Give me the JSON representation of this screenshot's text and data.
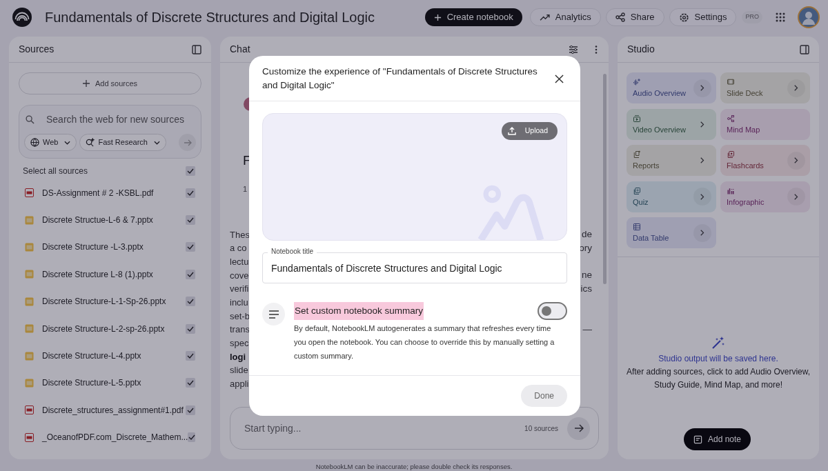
{
  "header": {
    "title": "Fundamentals of Discrete Structures and Digital Logic",
    "buttons": [
      {
        "kind": "primary",
        "label": "Create notebook"
      },
      {
        "kind": "analytics",
        "label": "Analytics"
      },
      {
        "kind": "share",
        "label": "Share"
      },
      {
        "kind": "settings",
        "label": "Settings"
      }
    ],
    "badge": "PRO"
  },
  "sources": {
    "title": "Sources",
    "add_button": "Add sources",
    "search": {
      "placeholder": "Search the web for new sources"
    },
    "chips": [
      "Web",
      "Fast Research"
    ],
    "select_all": {
      "label": "Select all sources",
      "checked": true
    },
    "items": [
      {
        "name": "DS-Assignment # 2 -KSBL.pdf",
        "kind": "pdf",
        "checked": true
      },
      {
        "name": "Discrete Structue-L-6 & 7.pptx",
        "kind": "slides",
        "checked": true
      },
      {
        "name": "Discrete Structure -L-3.pptx",
        "kind": "slides",
        "checked": true
      },
      {
        "name": "Discrete Structure L-8 (1).pptx",
        "kind": "slides",
        "checked": true
      },
      {
        "name": "Discrete Structure-L-1-Sp-26.pptx",
        "kind": "slides",
        "checked": true
      },
      {
        "name": "Discrete Structure-L-2-sp-26.pptx",
        "kind": "slides",
        "checked": true
      },
      {
        "name": "Discrete Structure-L-4.pptx",
        "kind": "slides",
        "checked": true
      },
      {
        "name": "Discrete Structure-L-5.pptx",
        "kind": "slides",
        "checked": true
      },
      {
        "name": "Discrete_structures_assignment#1.pdf",
        "kind": "pdf",
        "checked": true
      },
      {
        "name": "_OceanofPDF.com_Discrete_Mathem...",
        "kind": "pdf",
        "checked": true
      }
    ]
  },
  "chat": {
    "title": "Chat",
    "heading_fragments": [
      "F"
    ],
    "meta_fragment": "1",
    "lines": [
      {
        "start": "Thes",
        "end": "de",
        "bold": false
      },
      {
        "start": "a co",
        "end": "ory",
        "bold": false
      },
      {
        "start": "lectu",
        "bold": false
      },
      {
        "start": "cove",
        "end": "ne",
        "bold": false
      },
      {
        "start": "verifi",
        "end": "ics",
        "bold": false
      },
      {
        "start": "inclu",
        "bold": false
      },
      {
        "start": "set-b",
        "bold": false
      },
      {
        "start": "trans",
        "end": "—",
        "bold": false
      },
      {
        "start": "spec",
        "bold": false
      },
      {
        "start": "logi",
        "bold": true
      },
      {
        "start": "slide",
        "bold": false
      },
      {
        "start": "appli",
        "bold": false
      }
    ],
    "input": {
      "placeholder": "Start typing...",
      "source_count": "10 sources"
    }
  },
  "studio": {
    "title": "Studio",
    "tiles": [
      {
        "label": "Audio Overview",
        "kind": "audio",
        "arrow": true,
        "arrow_button": true
      },
      {
        "label": "Slide Deck",
        "kind": "slides",
        "arrow": true,
        "arrow_button": true
      },
      {
        "label": "Video Overview",
        "kind": "video",
        "arrow": true,
        "arrow_button": false
      },
      {
        "label": "Mind Map",
        "kind": "mindmap",
        "arrow": false
      },
      {
        "label": "Reports",
        "kind": "reports",
        "arrow": true,
        "arrow_button": false
      },
      {
        "label": "Flashcards",
        "kind": "flashcards",
        "arrow": true,
        "arrow_button": true
      },
      {
        "label": "Quiz",
        "kind": "quiz",
        "arrow": true,
        "arrow_button": true
      },
      {
        "label": "Infographic",
        "kind": "infographic",
        "arrow": true,
        "arrow_button": true
      },
      {
        "label": "Data Table",
        "kind": "table",
        "arrow": true,
        "arrow_button": true
      }
    ],
    "empty_title": "Studio output will be saved here.",
    "empty_text": "After adding sources, click to add Audio Overview, Study Guide, Mind Map, and more!",
    "add_note": "Add note"
  },
  "dialog": {
    "title": "Customize the experience of \"Fundamentals of Discrete Structures and Digital Logic\"",
    "upload": "Upload",
    "field": {
      "label": "Notebook title",
      "value": "Fundamentals of Discrete Structures and Digital Logic"
    },
    "summary": {
      "heading": "Set custom notebook summary",
      "text": "By default, NotebookLM autogenerates a summary that refreshes every time you open the notebook. You can choose to override this by manually setting a custom summary.",
      "on": false
    },
    "done": {
      "label": "Done",
      "disabled": true
    }
  },
  "footer": "NotebookLM can be inaccurate; please double check its responses."
}
